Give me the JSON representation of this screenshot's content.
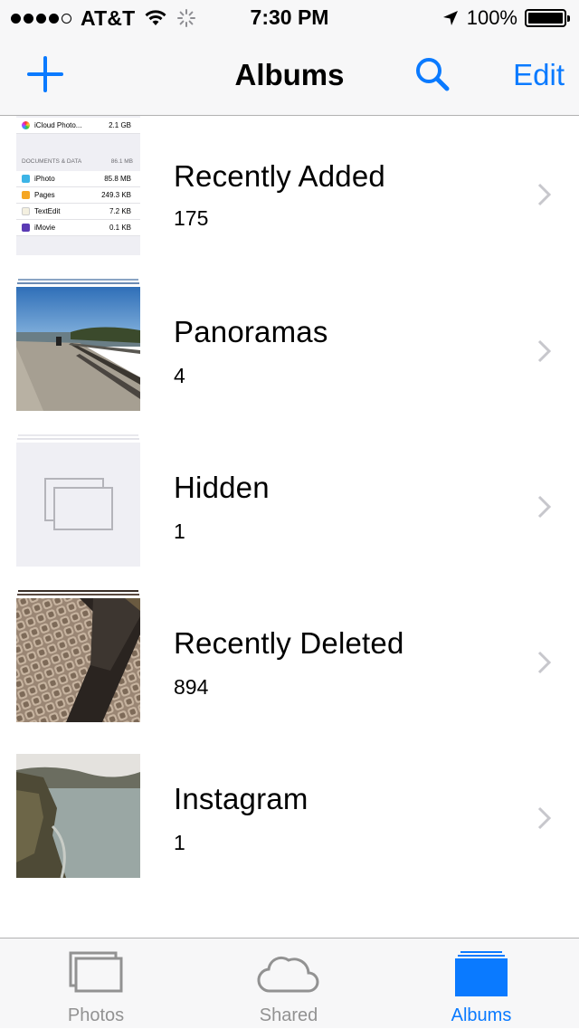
{
  "status_bar": {
    "carrier": "AT&T",
    "time": "7:30 PM",
    "battery_percent": "100%",
    "signal_bars_filled": 4,
    "signal_bars_total": 5
  },
  "nav": {
    "title": "Albums",
    "edit_label": "Edit",
    "add_icon": "plus-icon",
    "search_icon": "search-icon"
  },
  "albums": [
    {
      "name": "Recently Added",
      "count": "175",
      "thumb": {
        "rows": [
          {
            "label": "iCloud Photo...",
            "size": "2.1 GB"
          },
          {
            "label": "iPhoto",
            "size": "85.8 MB"
          },
          {
            "label": "Pages",
            "size": "249.3 KB"
          },
          {
            "label": "TextEdit",
            "size": "7.2 KB"
          },
          {
            "label": "iMovie",
            "size": "0.1 KB"
          }
        ],
        "section_header": "DOCUMENTS & DATA",
        "section_size": "86.1 MB"
      }
    },
    {
      "name": "Panoramas",
      "count": "4"
    },
    {
      "name": "Hidden",
      "count": "1"
    },
    {
      "name": "Recently Deleted",
      "count": "894"
    },
    {
      "name": "Instagram",
      "count": "1"
    }
  ],
  "tabs": [
    {
      "label": "Photos",
      "icon": "photos-icon",
      "active": false
    },
    {
      "label": "Shared",
      "icon": "cloud-icon",
      "active": false
    },
    {
      "label": "Albums",
      "icon": "albums-icon",
      "active": true
    }
  ],
  "colors": {
    "accent": "#0a7aff",
    "inactive_tab": "#929292",
    "chevron": "#c7c7cc",
    "bar_background": "#f7f7f8"
  }
}
